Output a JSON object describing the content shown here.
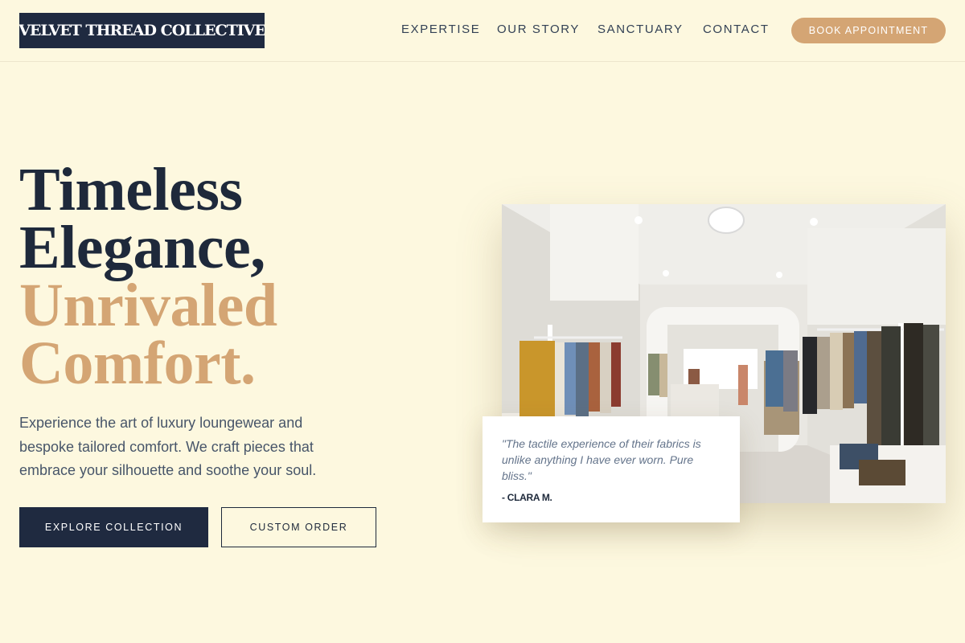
{
  "brand": {
    "logo_text": "VELVET THREAD COLLECTIVE"
  },
  "nav": {
    "links": [
      {
        "label": "EXPERTISE"
      },
      {
        "label": "OUR STORY"
      },
      {
        "label": "SANCTUARY"
      },
      {
        "label": "CONTACT"
      }
    ],
    "cta_label": "BOOK APPOINTMENT"
  },
  "hero": {
    "headline_line1": "Timeless",
    "headline_line2": "Elegance,",
    "headline_accent_line1": "Unrivaled",
    "headline_accent_line2": "Comfort.",
    "description": "Experience the art of luxury loungewear and bespoke tailored comfort. We craft pieces that embrace your silhouette and soothe your soul.",
    "primary_button": "EXPLORE COLLECTION",
    "secondary_button": "CUSTOM ORDER"
  },
  "testimonial": {
    "quote": "\"The tactile experience of their fabrics is unlike anything I have ever worn. Pure bliss.\"",
    "author": "- CLARA M."
  },
  "colors": {
    "background": "#fdf8df",
    "navy": "#1f2a40",
    "accent": "#d4a574",
    "text_muted": "#475569"
  }
}
